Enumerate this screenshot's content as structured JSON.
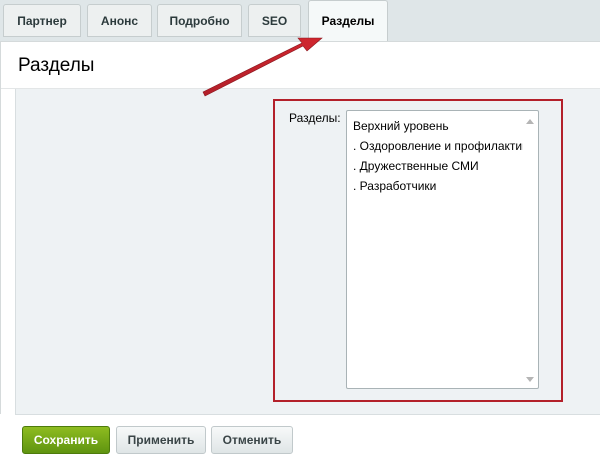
{
  "tabs": [
    {
      "label": "Партнер",
      "active": false
    },
    {
      "label": "Анонс",
      "active": false
    },
    {
      "label": "Подробно",
      "active": false
    },
    {
      "label": "SEO",
      "active": false
    },
    {
      "label": "Разделы",
      "active": true
    }
  ],
  "panel": {
    "title": "Разделы"
  },
  "sections_field": {
    "label": "Разделы:",
    "options": [
      "Верхний уровень",
      ". Оздоровление и профилактика",
      ". Дружественные СМИ",
      ". Разработчики"
    ]
  },
  "annotation": {
    "highlight_color": "#b3202a",
    "arrow_color": "#b3202a"
  },
  "buttons": {
    "save": "Сохранить",
    "apply": "Применить",
    "cancel": "Отменить"
  },
  "colors": {
    "tabstrip_bg": "#dfe6e8",
    "form_bg": "#eef2f4",
    "save_green": "#6ea516"
  }
}
